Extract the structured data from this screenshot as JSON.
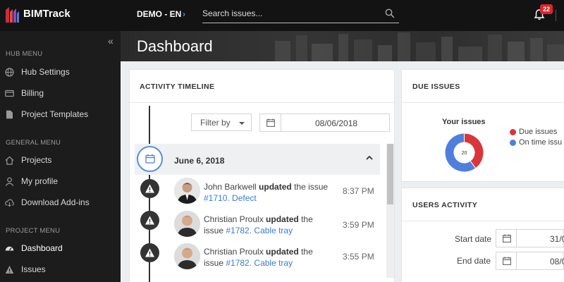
{
  "app": {
    "name": "BIMTrack"
  },
  "topbar": {
    "project": "DEMO - EN",
    "search_placeholder": "Search issues...",
    "notifications_count": "22"
  },
  "sidebar": {
    "sections": [
      {
        "title": "HUB MENU",
        "items": [
          {
            "label": "Hub Settings",
            "icon": "globe-icon"
          },
          {
            "label": "Billing",
            "icon": "credit-card-icon"
          },
          {
            "label": "Project Templates",
            "icon": "document-icon"
          }
        ]
      },
      {
        "title": "GENERAL MENU",
        "items": [
          {
            "label": "Projects",
            "icon": "home-icon"
          },
          {
            "label": "My profile",
            "icon": "user-icon"
          },
          {
            "label": "Download Add-ins",
            "icon": "cloud-download-icon"
          }
        ]
      },
      {
        "title": "PROJECT MENU",
        "items": [
          {
            "label": "Dashboard",
            "icon": "dashboard-icon",
            "active": true
          },
          {
            "label": "Issues",
            "icon": "warning-icon"
          }
        ]
      }
    ]
  },
  "page": {
    "title": "Dashboard"
  },
  "activity": {
    "title": "ACTIVITY TIMELINE",
    "filter_label": "Filter by",
    "date_value": "08/06/2018",
    "group_date": "June 6, 2018",
    "entries": [
      {
        "user": "John Barkwell",
        "action": "updated",
        "text_before_link": "the issue",
        "link": "#1710. Defect",
        "time": "8:37 PM"
      },
      {
        "user": "Christian Proulx",
        "action": "updated",
        "text_before_link": "the issue",
        "link": "#1782. Cable tray",
        "time": "3:59 PM"
      },
      {
        "user": "Christian Proulx",
        "action": "updated",
        "text_before_link": "the issue",
        "link": "#1782. Cable tray",
        "time": "3:55 PM"
      }
    ]
  },
  "due_issues": {
    "title": "DUE ISSUES",
    "chart_title": "Your issues",
    "center_value": "20",
    "legend": [
      {
        "label": "Due issues",
        "color": "#d9363b"
      },
      {
        "label": "On time issu",
        "color": "#4f7fdc"
      }
    ]
  },
  "chart_data": {
    "type": "pie",
    "title": "Your issues",
    "total": 20,
    "series": [
      {
        "name": "Due issues",
        "value": 8,
        "color": "#d9363b"
      },
      {
        "name": "On time issu",
        "value": 12,
        "color": "#4f7fdc"
      }
    ]
  },
  "users_activity": {
    "title": "USERS ACTIVITY",
    "start_label": "Start date",
    "start_value": "31/0",
    "end_label": "End date",
    "end_value": "08/0"
  }
}
